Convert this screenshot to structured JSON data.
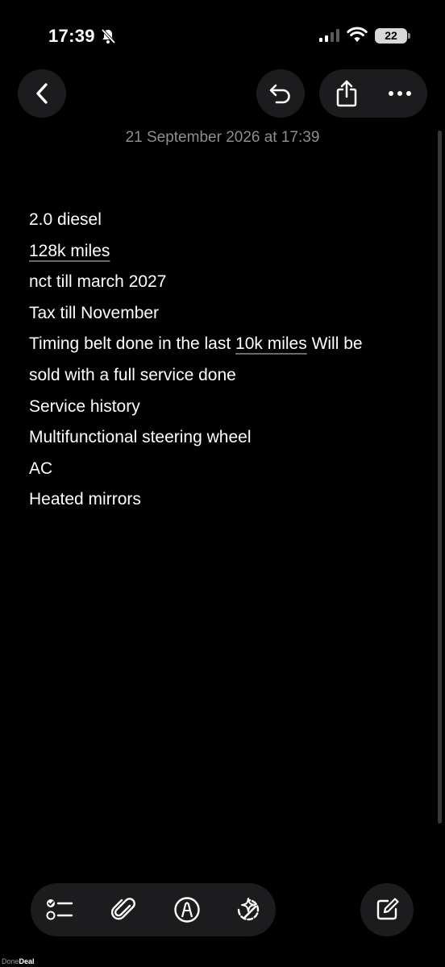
{
  "status_bar": {
    "time": "17:39",
    "battery": "22",
    "icons": [
      "bell-off-icon",
      "signal-icon",
      "wifi-icon",
      "battery-icon"
    ]
  },
  "nav": {
    "back_icon": "chevron-left-icon",
    "undo_icon": "undo-icon",
    "share_icon": "share-icon",
    "more_icon": "ellipsis-icon"
  },
  "note": {
    "date": "21 September 2026 at 17:39",
    "lines": {
      "l1": "2.0 diesel",
      "l2": "128k miles",
      "l3": "nct till march 2027",
      "l4": "Tax till November",
      "l5a": "Timing belt done in the last ",
      "l5b": "10k miles",
      "l5c": " Will be",
      "l6": "sold with a full service done",
      "l7": "Service history",
      "l8": "Multifunctional steering wheel",
      "l9": "AC",
      "l10": "Heated mirrors"
    }
  },
  "toolbar": {
    "icons": [
      "checklist-icon",
      "paperclip-icon",
      "markup-pen-icon",
      "sparkle-edit-icon"
    ],
    "compose_icon": "compose-icon"
  },
  "watermark": {
    "part1": "Done",
    "part2": "Deal"
  }
}
